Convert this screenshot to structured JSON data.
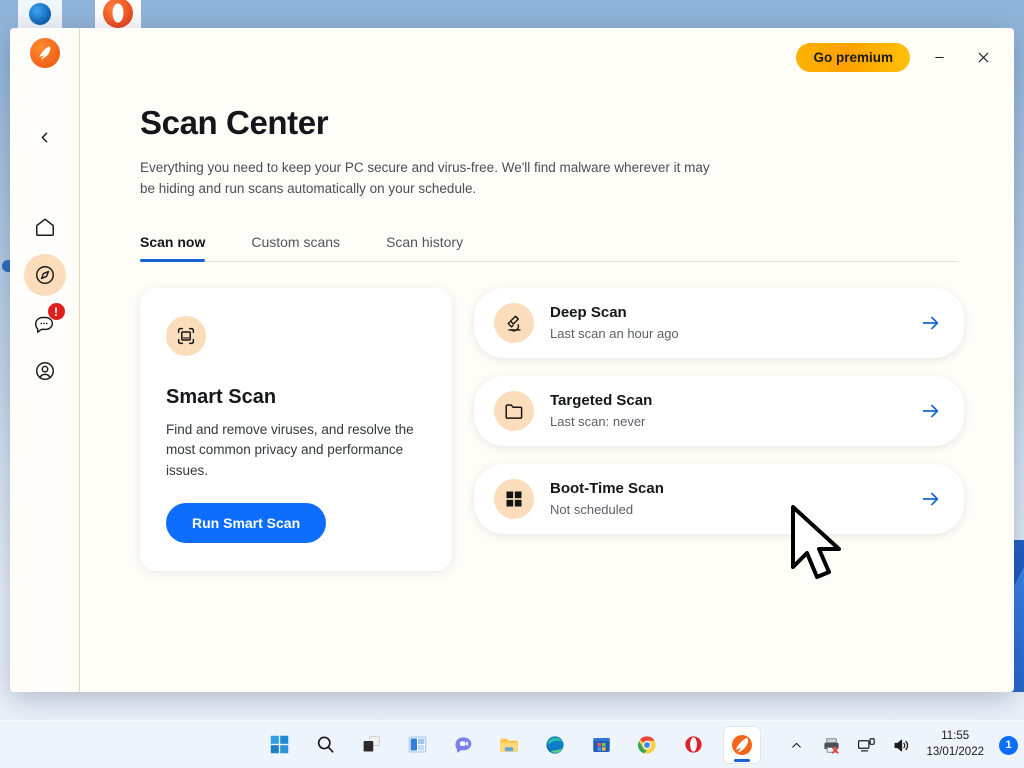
{
  "window": {
    "go_premium_label": "Go premium",
    "minimize_icon": "minimize-icon",
    "close_icon": "close-icon",
    "logo_icon": "avast-logo-icon"
  },
  "sidebar": {
    "back_icon": "chevron-left-icon",
    "items": [
      {
        "name": "home",
        "icon": "home-icon",
        "active": false
      },
      {
        "name": "explore",
        "icon": "compass-icon",
        "active": true
      },
      {
        "name": "messages",
        "icon": "chat-bubble-icon",
        "active": false,
        "badge": "!"
      },
      {
        "name": "account",
        "icon": "user-circle-icon",
        "active": false
      }
    ]
  },
  "page": {
    "title": "Scan Center",
    "subtitle": "Everything you need to keep your PC secure and virus-free. We'll find malware wherever it may be hiding and run scans automatically on your schedule."
  },
  "tabs": [
    {
      "label": "Scan now",
      "active": true
    },
    {
      "label": "Custom scans",
      "active": false
    },
    {
      "label": "Scan history",
      "active": false
    }
  ],
  "smart_scan": {
    "icon": "scan-frame-icon",
    "title": "Smart Scan",
    "description": "Find and remove viruses, and resolve the most common privacy and performance issues.",
    "button_label": "Run Smart Scan"
  },
  "scan_options": [
    {
      "icon": "microscope-icon",
      "title": "Deep Scan",
      "status": "Last scan an hour ago",
      "arrow_icon": "arrow-right-icon"
    },
    {
      "icon": "folder-icon",
      "title": "Targeted Scan",
      "status": "Last scan: never",
      "arrow_icon": "arrow-right-icon"
    },
    {
      "icon": "windows-logo-icon",
      "title": "Boot-Time Scan",
      "status": "Not scheduled",
      "arrow_icon": "arrow-right-icon"
    }
  ],
  "taskbar": {
    "apps": [
      {
        "name": "start",
        "icon": "windows-start-icon"
      },
      {
        "name": "search",
        "icon": "search-icon"
      },
      {
        "name": "task-view",
        "icon": "task-view-icon"
      },
      {
        "name": "widgets",
        "icon": "widgets-icon"
      },
      {
        "name": "chat",
        "icon": "teams-chat-icon"
      },
      {
        "name": "file-explorer",
        "icon": "folder-icon"
      },
      {
        "name": "edge",
        "icon": "edge-icon"
      },
      {
        "name": "store",
        "icon": "microsoft-store-icon"
      },
      {
        "name": "chrome",
        "icon": "chrome-icon"
      },
      {
        "name": "opera",
        "icon": "opera-icon"
      },
      {
        "name": "avast",
        "icon": "avast-icon",
        "active": true
      }
    ],
    "tray": {
      "overflow_icon": "chevron-up-icon",
      "printer_icon": "printer-error-icon",
      "network_icon": "network-icon",
      "volume_icon": "volume-icon",
      "time": "11:55",
      "date": "13/01/2022",
      "notification_count": "1"
    }
  },
  "colors": {
    "accent_blue": "#0d6efd",
    "tab_underline": "#1a62d4",
    "premium_gradient_start": "#ffb300",
    "premium_gradient_end": "#ffc107",
    "icon_circle": "#fbdcbb",
    "avast_orange": "#f2661a",
    "alert_red": "#e01e1e",
    "window_bg": "#fffdf8"
  }
}
